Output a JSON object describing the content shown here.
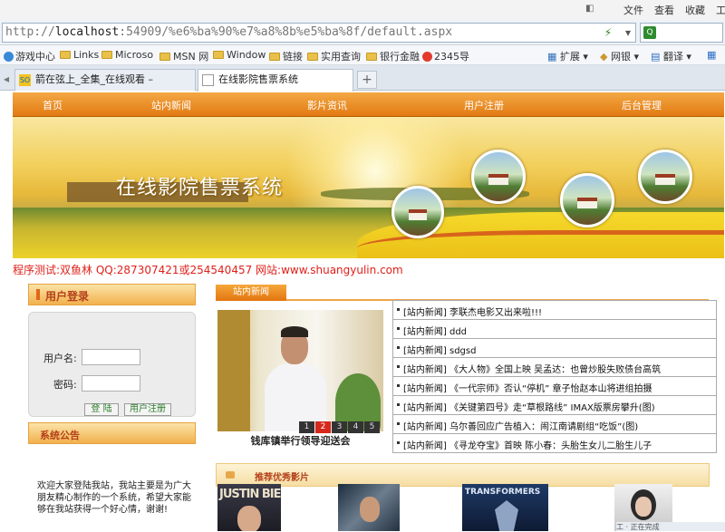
{
  "browser": {
    "menu": [
      "文件",
      "查看",
      "收藏",
      "工"
    ],
    "address": "http://localhost:54909/%e6%ba%90%e7%a8%8b%e5%ba%8f/default.aspx",
    "address_host": "localhost",
    "search_placeholder": "",
    "favorites": [
      {
        "label": "游戏中心",
        "type": "icon"
      },
      {
        "label": "Links",
        "type": "folder"
      },
      {
        "label": "Microso",
        "type": "folder"
      },
      {
        "label": "MSN 网",
        "type": "folder"
      },
      {
        "label": "Window",
        "type": "folder"
      },
      {
        "label": "链接",
        "type": "folder"
      },
      {
        "label": "实用查询",
        "type": "folder"
      },
      {
        "label": "银行金融",
        "type": "folder"
      },
      {
        "label": "2345导",
        "type": "icon"
      }
    ],
    "toolbar_right": [
      "扩展",
      "网银",
      "翻译"
    ],
    "tabs": [
      {
        "label": "箭在弦上_全集_在线观看 –",
        "active": false
      },
      {
        "label": "在线影院售票系统",
        "active": true
      }
    ]
  },
  "nav": [
    "首页",
    "站内新闻",
    "影片资讯",
    "用户注册",
    "后台管理"
  ],
  "banner": {
    "title": "在线影院售票系统"
  },
  "credit": "程序测试:双鱼林 QQ:287307421或254540457 网站:www.shuangyulin.com",
  "login": {
    "heading": "用户登录",
    "username_label": "用户名:",
    "password_label": "密码:",
    "login_button": "登 陆",
    "register_button": "用户注册"
  },
  "notice": {
    "heading": "系统公告",
    "text": "欢迎大家登陆我站，我站主要是为广大朋友精心制作的一个系统，希望大家能够在我站获得一个好心情，谢谢!"
  },
  "news": {
    "heading": "站内新闻",
    "photo_caption": "钱库镇举行领导迎送会",
    "pager": [
      "1",
      "2",
      "3",
      "4",
      "5"
    ],
    "pager_active": 2,
    "items": [
      "[站内新闻] 李联杰电影又出来啦!!!",
      "[站内新闻] ddd",
      "[站内新闻] sdgsd",
      "[站内新闻] 《大人物》全国上映 吴孟达：也曾炒股失败债台高筑",
      "[站内新闻] 《一代宗师》否认“停机” 章子怡赵本山将进组拍摄",
      "[站内新闻] 《关键第四号》走“草根路线” IMAX版票房攀升(图)",
      "[站内新闻] 乌尔善回应广告植入：闹江南请剧组“吃饭”(图)",
      "[站内新闻] 《寻龙夺宝》首映 陈小春：头胎生女儿二胎生儿子"
    ]
  },
  "recommend": {
    "heading": "推荐优秀影片",
    "posters": [
      "JUSTIN BIEBER",
      "",
      "TRANSFORMERS",
      ""
    ]
  },
  "status": "工 · 正在完成"
}
